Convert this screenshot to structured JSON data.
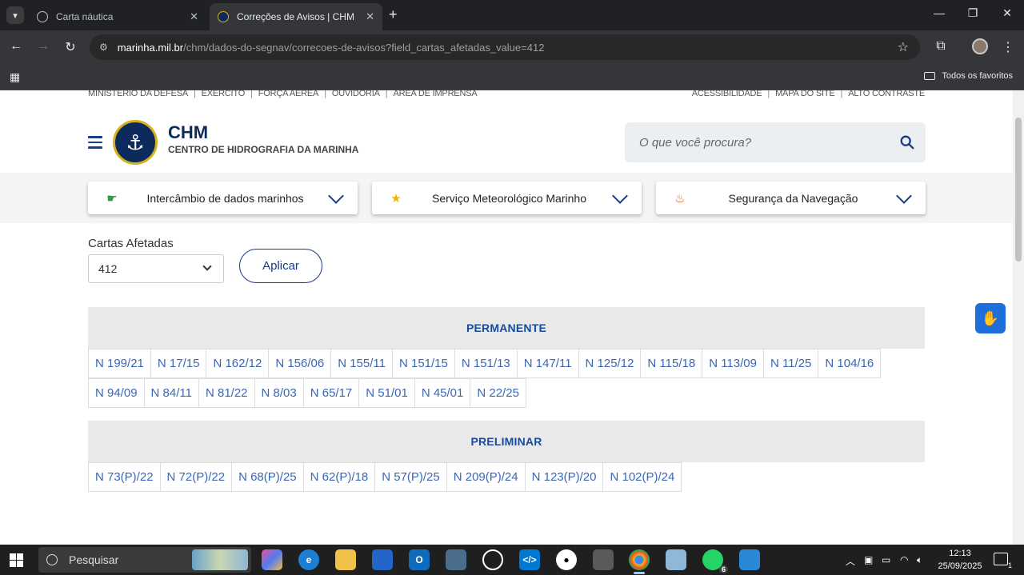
{
  "browser": {
    "tabs": [
      {
        "title": "Carta náutica",
        "active": false
      },
      {
        "title": "Correções de Avisos | CHM",
        "active": true
      }
    ],
    "url_host": "marinha.mil.br",
    "url_path": "/chm/dados-do-segnav/correcoes-de-avisos?field_cartas_afetadas_value=412",
    "bookmarks_label": "Todos os favoritos"
  },
  "site": {
    "top_links_left": [
      "MINISTÉRIO DA DEFESA",
      "EXÉRCITO",
      "FORÇA AÉREA",
      "OUVIDORIA",
      "ÁREA DE IMPRENSA"
    ],
    "top_links_right": [
      "ACESSIBILIDADE",
      "MAPA DO SITE",
      "ALTO CONTRASTE"
    ],
    "brand": "CHM",
    "brand_sub": "CENTRO DE HIDROGRAFIA DA MARINHA",
    "search_placeholder": "O que você procura?",
    "nav": [
      {
        "label": "Intercâmbio de dados marinhos",
        "icon": "pointing-hand-icon",
        "color": "#2ea043"
      },
      {
        "label": "Serviço Meteorológico Marinho",
        "icon": "star-icon",
        "color": "#f0b400"
      },
      {
        "label": "Segurança da Navegação",
        "icon": "flame-icon",
        "color": "#e8541c"
      }
    ]
  },
  "filter": {
    "label": "Cartas Afetadas",
    "value": "412",
    "apply_label": "Aplicar"
  },
  "sections": {
    "permanente": {
      "title": "PERMANENTE",
      "row1": [
        "N 199/21",
        "N 17/15",
        "N 162/12",
        "N 156/06",
        "N 155/11",
        "N 151/15",
        "N 151/13",
        "N 147/11",
        "N 125/12",
        "N 115/18",
        "N 113/09",
        "N 11/25",
        "N 104/16"
      ],
      "row2": [
        "N 94/09",
        "N 84/11",
        "N 81/22",
        "N 8/03",
        "N 65/17",
        "N 51/01",
        "N 45/01",
        "N 22/25"
      ]
    },
    "preliminar": {
      "title": "PRELIMINAR",
      "row1": [
        "N 73(P)/22",
        "N 72(P)/22",
        "N 68(P)/25",
        "N 62(P)/18",
        "N 57(P)/25",
        "N 209(P)/24",
        "N 123(P)/20",
        "N 102(P)/24"
      ]
    }
  },
  "taskbar": {
    "search_label": "Pesquisar",
    "time": "12:13",
    "date": "25/09/2025",
    "whatsapp_badge": "6",
    "notif_count": "1"
  }
}
